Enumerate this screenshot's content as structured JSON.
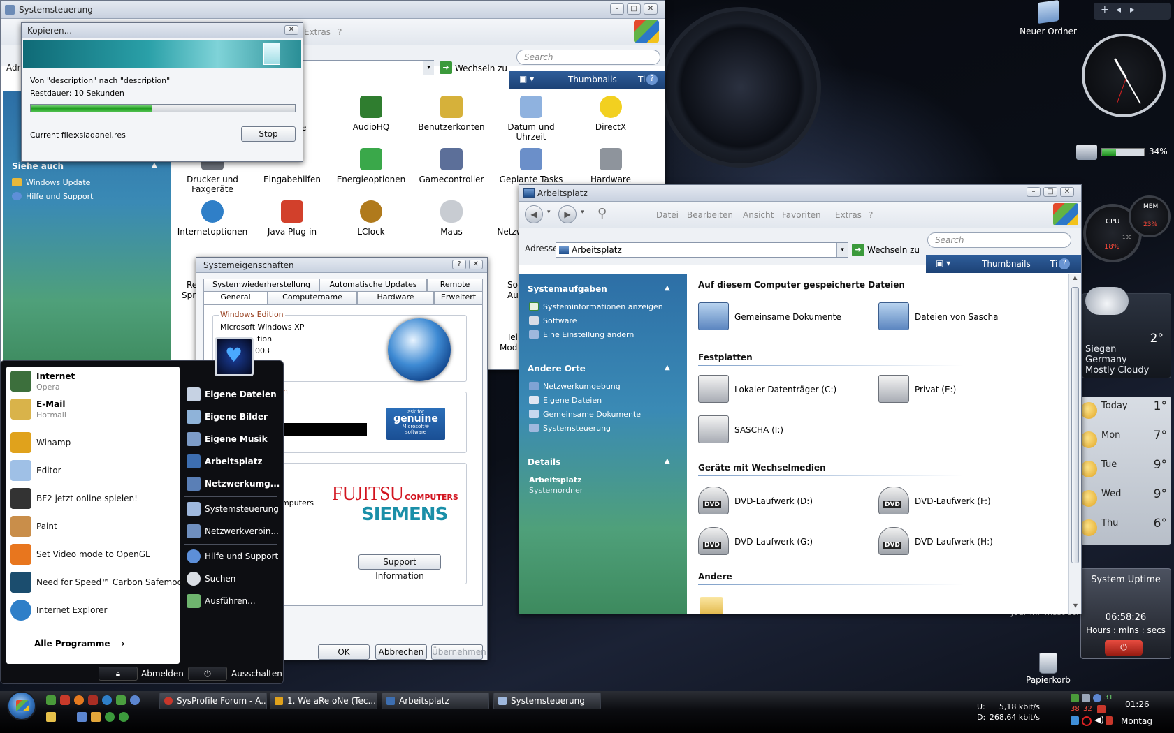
{
  "desktop": {
    "icons": [
      {
        "label": "Neuer Ordner"
      },
      {
        "label": "joar ihr wisst scho"
      },
      {
        "label": "Papierkorb"
      }
    ]
  },
  "control_panel": {
    "title": "Systemsteuerung",
    "menu": [
      "Extras",
      "?"
    ],
    "address_label": "Adr",
    "goto_label": "Wechseln zu",
    "search_placeholder": "Search",
    "view_label": "Thumbnails",
    "view_extra": "Ti",
    "see_also_header": "Siehe auch",
    "see_also": [
      "Windows Update",
      "Hilfe und Support"
    ],
    "icons": [
      {
        "label": "AudioHQ",
        "color": "#2f7d2f"
      },
      {
        "label": "Benutzerkonten",
        "color": "#d6b13a"
      },
      {
        "label": "Datum und Uhrzeit",
        "color": "#8fb2df"
      },
      {
        "label": "DirectX",
        "color": "#f2d020"
      },
      {
        "label": "Drucker und Faxgeräte",
        "color": "#6a6f78"
      },
      {
        "label": "Eingabehilfen",
        "color": "#3b8bd1"
      },
      {
        "label": "Energieoptionen",
        "color": "#3aa84a"
      },
      {
        "label": "Gamecontroller",
        "color": "#5c6f99"
      },
      {
        "label": "Geplante Tasks",
        "color": "#6b8fc9"
      },
      {
        "label": "Hardware",
        "color": "#8e949c"
      },
      {
        "label": "Internetoptionen",
        "color": "#2f7fc8"
      },
      {
        "label": "Java Plug-in",
        "color": "#d2402b"
      },
      {
        "label": "LClock",
        "color": "#b07a1c"
      },
      {
        "label": "Maus",
        "color": "#c8ccd2"
      },
      {
        "label": "Netzw",
        "color": "#4a78b8"
      }
    ],
    "partial_labels": [
      "Re",
      "Spra",
      "So",
      "Au",
      "Tel",
      "Mod",
      "e"
    ]
  },
  "copy_dialog": {
    "title": "Kopieren...",
    "from_to": "Von \"description\" nach \"description\"",
    "remaining": "Restdauer: 10 Sekunden",
    "progress": 0.46,
    "current_file_label": "Current file:",
    "current_file": "xsladanel.res",
    "stop_label": "Stop"
  },
  "system_props": {
    "title": "Systemeigenschaften",
    "tabs_row1": [
      "Systemwiederherstellung",
      "Automatische Updates",
      "Remote"
    ],
    "tabs_row2": [
      "General",
      "Computername",
      "Hardware",
      "Erweitert"
    ],
    "group_edition": "Windows Edition",
    "edition_line1": "Microsoft Windows XP",
    "edition_line2": "ition",
    "edition_line3": "003",
    "registered_fragment": "n",
    "manufacturer_fragment": "mputers",
    "genuine_small": "ask for",
    "genuine_big": "genuine",
    "genuine_ms": "Microsoft®",
    "genuine_sw": "software",
    "fujitsu": "FUJITSU",
    "computers": "COMPUTERS",
    "siemens": "SIEMENS",
    "support_button": "Support Information",
    "ok": "OK",
    "cancel": "Abbrechen",
    "apply": "Übernehmen"
  },
  "my_computer": {
    "title": "Arbeitsplatz",
    "menu": [
      "Datei",
      "Bearbeiten",
      "Ansicht",
      "Favoriten",
      "Extras",
      "?"
    ],
    "address_label": "Adresse",
    "address_value": "Arbeitsplatz",
    "goto_label": "Wechseln zu",
    "search_placeholder": "Search",
    "view_label": "Thumbnails",
    "view_extra": "Ti",
    "tasks": {
      "system_header": "Systemaufgaben",
      "system_items": [
        "Systeminformationen anzeigen",
        "Software",
        "Eine Einstellung ändern"
      ],
      "places_header": "Andere Orte",
      "places_items": [
        "Netzwerkumgebung",
        "Eigene Dateien",
        "Gemeinsame Dokumente",
        "Systemsteuerung"
      ],
      "details_header": "Details",
      "details_name": "Arbeitsplatz",
      "details_type": "Systemordner"
    },
    "sections": {
      "files": "Auf diesem Computer gespeicherte Dateien",
      "drives": "Festplatten",
      "removable": "Geräte mit Wechselmedien",
      "other": "Andere"
    },
    "files": [
      "Gemeinsame Dokumente",
      "Dateien von Sascha"
    ],
    "drives": [
      "Lokaler Datenträger (C:)",
      "Privat (E:)",
      "SASCHA (I:)"
    ],
    "removable": [
      "DVD-Laufwerk (D:)",
      "DVD-Laufwerk (F:)",
      "DVD-Laufwerk (G:)",
      "DVD-Laufwerk (H:)"
    ],
    "dvd_badge": "DVD"
  },
  "start_menu": {
    "pinned": [
      {
        "title": "Internet",
        "sub": "Opera",
        "color": "#3c6f3c"
      },
      {
        "title": "E-Mail",
        "sub": "Hotmail",
        "color": "#d9b34a"
      }
    ],
    "recent": [
      {
        "label": "Winamp",
        "color": "#e0a21c"
      },
      {
        "label": "Editor",
        "color": "#9fc0e6"
      },
      {
        "label": "BF2 jetzt online spielen!",
        "color": "#333333"
      },
      {
        "label": "Paint",
        "color": "#c98e4a"
      },
      {
        "label": "Set Video mode to OpenGL",
        "color": "#e8761e"
      },
      {
        "label": "Need for Speed™ Carbon Safemode",
        "color": "#1b4d6e"
      },
      {
        "label": "Internet Explorer",
        "color": "#2f7fc8"
      }
    ],
    "all_programs": "Alle Programme",
    "places": [
      {
        "label": "Eigene Dateien",
        "bold": true
      },
      {
        "label": "Eigene Bilder",
        "bold": true
      },
      {
        "label": "Eigene Musik",
        "bold": true
      },
      {
        "label": "Arbeitsplatz",
        "bold": true
      },
      {
        "label": "Netzwerkumg...",
        "bold": true
      },
      {
        "label": "Systemsteuerung",
        "bold": false
      },
      {
        "label": "Netzwerkverbin...",
        "bold": false
      },
      {
        "label": "Hilfe und Support",
        "bold": false
      },
      {
        "label": "Suchen",
        "bold": false
      },
      {
        "label": "Ausführen...",
        "bold": false
      }
    ],
    "logoff": "Abmelden",
    "shutdown": "Ausschalten"
  },
  "taskbar": {
    "tasks": [
      {
        "label": "SysProfile Forum - A..."
      },
      {
        "label": "1. We aRe oNe (Tec..."
      },
      {
        "label": "Arbeitsplatz"
      },
      {
        "label": "Systemsteuerung"
      }
    ],
    "net_up_label": "U:",
    "net_up": "5,18 kbit/s",
    "net_down_label": "D:",
    "net_down": "268,64 kbit/s",
    "time": "01:26",
    "day": "Montag",
    "tray_numbers": [
      "31",
      "38",
      "32"
    ]
  },
  "gadgets": {
    "battery_percent": 34,
    "battery_label": "34%",
    "cpu_label": "CPU",
    "cpu_value": "18%",
    "mem_label": "MEM",
    "mem_value": "23%",
    "gauge_max": "100",
    "weather": {
      "temp": "2°",
      "city": "Siegen",
      "country": "Germany",
      "condition": "Mostly Cloudy",
      "forecast": [
        {
          "day": "Today",
          "temp": "1°"
        },
        {
          "day": "Mon",
          "temp": "7°"
        },
        {
          "day": "Tue",
          "temp": "9°"
        },
        {
          "day": "Wed",
          "temp": "9°"
        },
        {
          "day": "Thu",
          "temp": "6°"
        }
      ]
    },
    "uptime": {
      "title": "System Uptime",
      "value": "06:58:26",
      "label": "Hours : mins : secs"
    }
  }
}
